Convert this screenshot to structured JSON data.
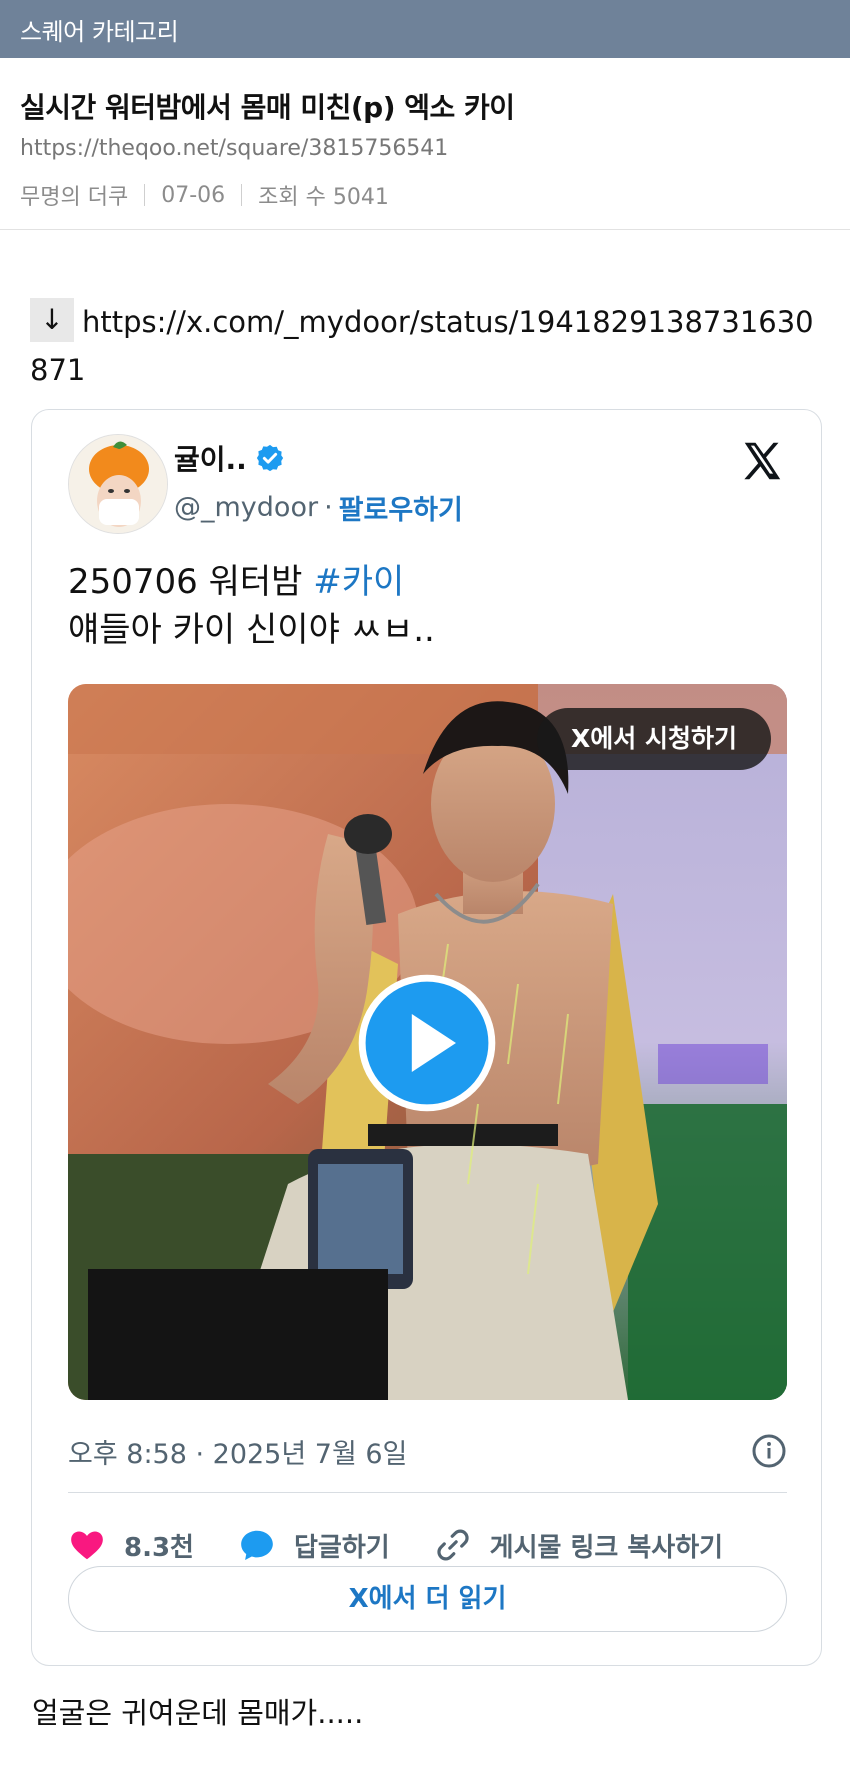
{
  "category_bar": {
    "label": "스퀘어 카테고리",
    "color": "#6f8299"
  },
  "post": {
    "title": "실시간 워터밤에서 몸매 미친(p) 엑소 카이",
    "url": "https://theqoo.net/square/3815756541",
    "author": "무명의 더쿠",
    "date": "07-06",
    "views": "조회 수 5041"
  },
  "content": {
    "arrow": "↓",
    "link": "https://x.com/_mydoor/status/1941829138731630871",
    "caption": "얼굴은 귀여운데 몸매가....."
  },
  "tweet": {
    "name": "귤이..",
    "handle": "@_mydoor",
    "separator": "·",
    "follow": "팔로우하기",
    "text_line1_prefix": "250706 워터밤 ",
    "hashtag": "#카이",
    "text_line2": "얘들아 카이 신이야 ㅆㅂ..",
    "watch_on_x": "X에서 시청하기",
    "timestamp": "오후 8:58 · 2025년 7월 6일",
    "likes": "8.3천",
    "reply": "답글하기",
    "copy_link": "게시물 링크 복사하기",
    "read_more": "X에서 더 읽기",
    "icons": {
      "verified": "verified-badge-icon",
      "x_logo": "x-logo-icon",
      "play": "play-icon",
      "info": "info-icon",
      "heart": "heart-icon",
      "reply": "reply-bubble-icon",
      "link": "link-icon"
    },
    "colors": {
      "link": "#1d77c4",
      "heart": "#f91880",
      "verified": "#1d9bf0"
    }
  }
}
